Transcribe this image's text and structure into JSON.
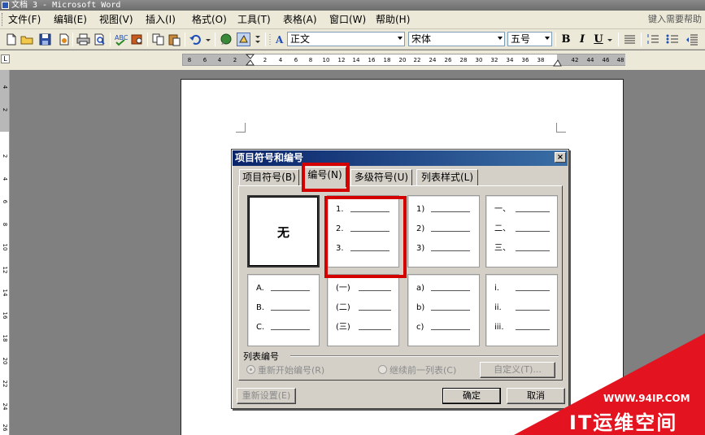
{
  "window": {
    "title": "文档 3 - Microsoft Word"
  },
  "menubar": {
    "items": [
      "文件(F)",
      "编辑(E)",
      "视图(V)",
      "插入(I)",
      "格式(O)",
      "工具(T)",
      "表格(A)",
      "窗口(W)",
      "帮助(H)"
    ],
    "help_search": "键入需要帮助"
  },
  "toolbar": {
    "icons": [
      "new-icon",
      "open-icon",
      "save-icon",
      "permission-icon",
      "print-icon",
      "print-preview-icon",
      "spelling-icon",
      "research-icon",
      "copy-icon",
      "paste-icon",
      "undo-icon",
      "hyperlink-icon",
      "drawing-icon"
    ],
    "style": "正文",
    "font": "宋体",
    "size": "五号",
    "bold": "B",
    "italic": "I",
    "underline": "U"
  },
  "ruler": {
    "corner": "L",
    "ticks": [
      "8",
      "6",
      "4",
      "2",
      "2",
      "4",
      "6",
      "8",
      "10",
      "12",
      "14",
      "16",
      "18",
      "20",
      "22",
      "24",
      "26",
      "28",
      "30",
      "32",
      "34",
      "36",
      "38",
      "42",
      "44",
      "46",
      "48"
    ],
    "vticks": [
      "4",
      "2",
      "2",
      "4",
      "6",
      "8",
      "10",
      "12",
      "14",
      "16",
      "18",
      "20",
      "22",
      "24",
      "26"
    ]
  },
  "dialog": {
    "title": "项目符号和编号",
    "close": "×",
    "tabs": [
      "项目符号(B)",
      "编号(N)",
      "多级符号(U)",
      "列表样式(L)"
    ],
    "active_tab": "编号(N)",
    "none_label": "无",
    "gallery": [
      [
        "1.",
        "2.",
        "3."
      ],
      [
        "1)",
        "2)",
        "3)"
      ],
      [
        "一、",
        "二、",
        "三、"
      ],
      [
        "A.",
        "B.",
        "C."
      ],
      [
        "(一)",
        "(二)",
        "(三)"
      ],
      [
        "a)",
        "b)",
        "c)"
      ],
      [
        "i.",
        "ii.",
        "iii."
      ]
    ],
    "list_numbering_label": "列表编号",
    "restart_numbering": "重新开始编号(R)",
    "continue_previous": "继续前一列表(C)",
    "customize": "自定义(T)...",
    "reset": "重新设置(E)",
    "ok": "确定",
    "cancel": "取消"
  },
  "watermark": {
    "url": "WWW.94IP.COM",
    "name": "IT运维空间"
  }
}
